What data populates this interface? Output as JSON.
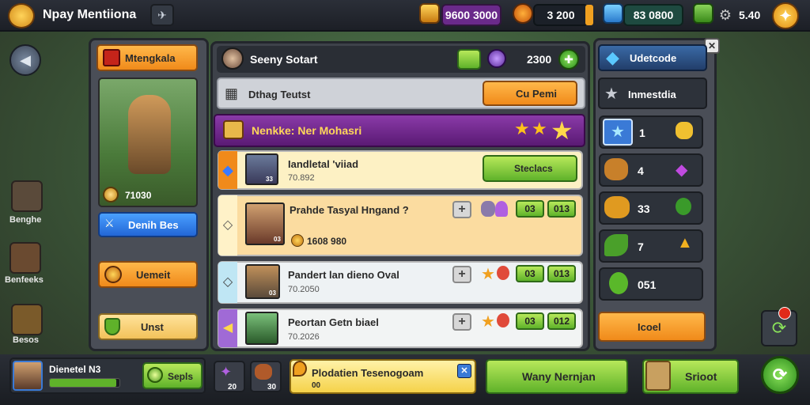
{
  "topbar": {
    "title": "Npay Mentiiona",
    "gold": "9600 3000",
    "coins": "3 200",
    "gems": "83 0800",
    "tokens": "5.40"
  },
  "left_nav": [
    {
      "label": "Benghe"
    },
    {
      "label": "Benfeeks"
    },
    {
      "label": "Besos"
    }
  ],
  "hero_panel": {
    "header": "Mtengkala",
    "power": "71030",
    "detail_button": "Denih Bes",
    "upgrade_button": "Uemeit",
    "unit_button": "Unst"
  },
  "main_panel": {
    "player_name": "Seeny Sotart",
    "currency": "2300",
    "section_title": "Dthag Teutst",
    "section_button": "Cu Pemi",
    "featured_title": "Nenkke: Ner Mohasri",
    "rows": [
      {
        "title": "Iandletal 'viiad",
        "sub": "70.892",
        "level": "33",
        "action": "Steclacs"
      },
      {
        "title": "Prahde Tasyal Hngand ?",
        "sub": "1608 980",
        "level": "03",
        "mid": "03",
        "right": "013"
      },
      {
        "title": "Pandert lan dieno Oval",
        "sub": "70.2050",
        "level": "03",
        "mid": "03",
        "right": "013"
      },
      {
        "title": "Peortan Getn biael",
        "sub": "70.2026",
        "level": "",
        "mid": "03",
        "right": "012"
      }
    ]
  },
  "right_panel": {
    "header": "Udetcode",
    "subheader": "Inmestdia",
    "tiles": [
      {
        "value": "1"
      },
      {
        "value": "4"
      },
      {
        "value": "33"
      },
      {
        "value": "7"
      },
      {
        "value": "051"
      }
    ],
    "button": "Icoel"
  },
  "bottom": {
    "player": "Dienetel N3",
    "xp_button": "Sepls",
    "slot1": "20",
    "slot2": "30",
    "quest_title": "Plodatien Tesenogoam",
    "quest_sub": "00",
    "btn1": "Wany Nernjan",
    "btn2": "Srioot"
  },
  "colors": {
    "accent": "#f08a1a",
    "green": "#5fb22a",
    "blue": "#2266d6",
    "purple": "#6a2a8a"
  }
}
